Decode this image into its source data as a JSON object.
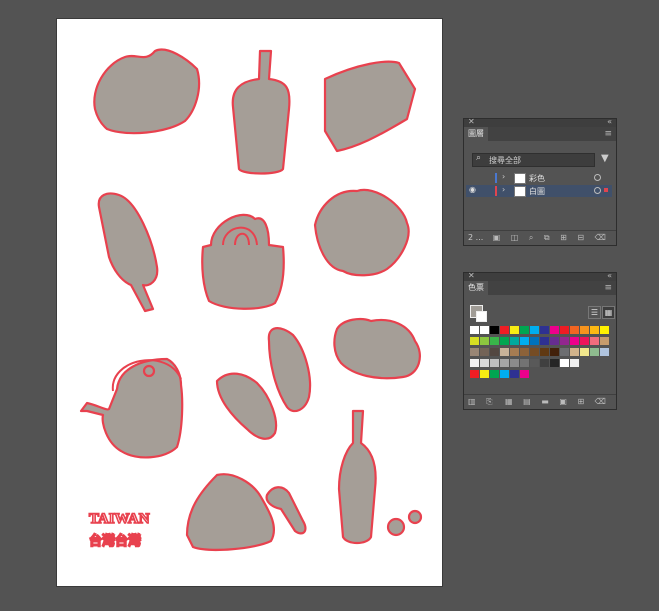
{
  "layers_panel": {
    "title": "圖層",
    "search_placeholder": "搜尋全部",
    "layers": [
      {
        "name": "彩色",
        "color": "#4a78d0",
        "visible": false
      },
      {
        "name": "白圖",
        "color": "#e0454f",
        "visible": true,
        "selected": true
      }
    ],
    "count_label": "2 ..."
  },
  "swatches_panel": {
    "title": "色票",
    "rows": [
      [
        "#ffffff",
        "#ffffff",
        "#000000",
        "#ee1d24",
        "#f7ec13",
        "#00a651",
        "#00aeef",
        "#2e3192",
        "#ec008c",
        "#ed1c24",
        "#f26522",
        "#f7941d",
        "#fdb913",
        "#fff200"
      ],
      [
        "#d7df23",
        "#8dc63f",
        "#39b54a",
        "#00a651",
        "#00a99d",
        "#00aeef",
        "#0072bc",
        "#2e3192",
        "#662d91",
        "#92278f",
        "#ec008c",
        "#ed145b",
        "#f26d7d",
        "#c69c6d"
      ],
      [
        "#998675",
        "#736357",
        "#534741",
        "#c7b299",
        "#a67c52",
        "#8c6239",
        "#754c24",
        "#603913",
        "#42210b",
        "#6d6e71",
        "#d2b48c",
        "#f0e68c",
        "#8fbc8f",
        "#b0c4de"
      ],
      [
        "#f2f2f2",
        "#d9d9d9",
        "#bfbfbf",
        "#a6a6a6",
        "#8c8c8c",
        "#737373",
        "#595959",
        "#404040",
        "#262626",
        "#ffffff",
        "#eeeeee"
      ],
      [
        "#ee1d24",
        "#f7ec13",
        "#00a651",
        "#00aeef",
        "#2e3192",
        "#ec008c"
      ]
    ]
  },
  "artwork": {
    "text_line1": "TAIWAN",
    "text_line2": "台灣台灣"
  }
}
